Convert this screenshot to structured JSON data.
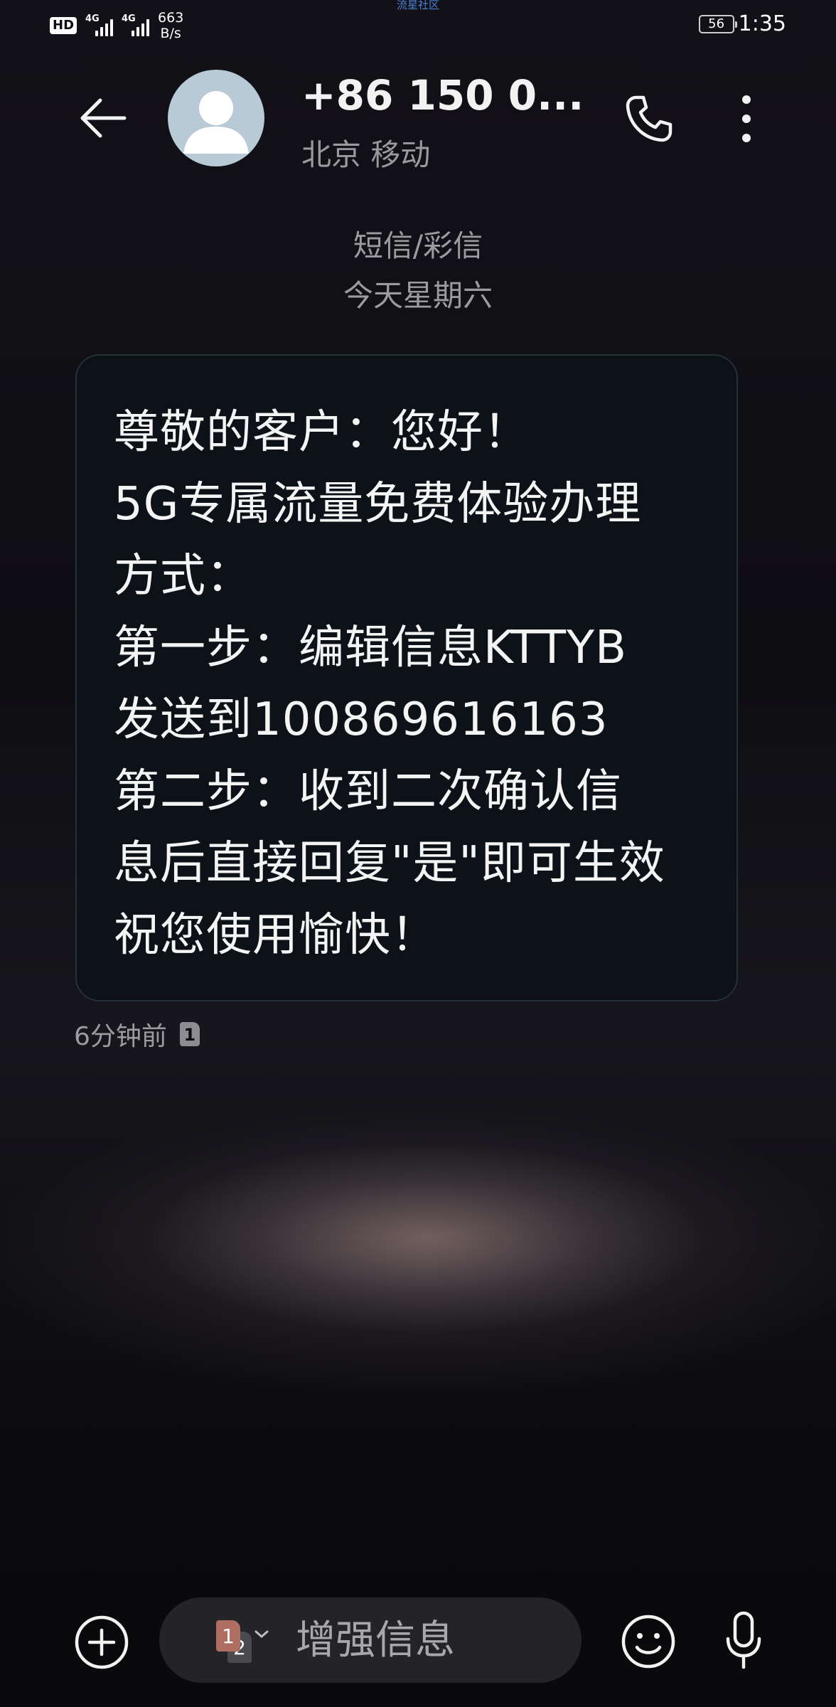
{
  "status_bar": {
    "hd_label": "HD",
    "sim1_network": "4G",
    "sim2_network": "4G",
    "net_speed_value": "663",
    "net_speed_unit": "B/s",
    "center_label": "流星社区",
    "battery_level": "56",
    "time": "1:35"
  },
  "header": {
    "contact_name": "+86 150 0...",
    "contact_location": "北京 移动",
    "icons": [
      "back-arrow-icon",
      "avatar-person-icon",
      "phone-icon",
      "more-vertical-icon"
    ]
  },
  "thread": {
    "message_type": "短信/彩信",
    "day_label": "今天星期六"
  },
  "message": {
    "lines": [
      "尊敬的客户：您好！",
      "5G专属流量免费体验办理",
      "方式：",
      "第一步：编辑信息KTTYB",
      "发送到100869616163",
      "第二步：收到二次确认信",
      "息后直接回复\"是\"即可生效",
      "祝您使用愉快！"
    ],
    "time_ago": "6分钟前",
    "sim_slot": "1"
  },
  "composer": {
    "sim_primary": "1",
    "sim_secondary": "2",
    "placeholder": "增强信息",
    "value": "",
    "icons": [
      "add-circle-icon",
      "sim-switch-icon",
      "chevron-down-icon",
      "emoji-icon",
      "microphone-icon"
    ]
  },
  "colors": {
    "background": "#0d0c10",
    "bubble": "#0c1218",
    "text_primary": "#f4f4f4",
    "text_secondary": "#9c9ca0",
    "avatar": "#b7cad6",
    "sim1": "#b06e62"
  }
}
